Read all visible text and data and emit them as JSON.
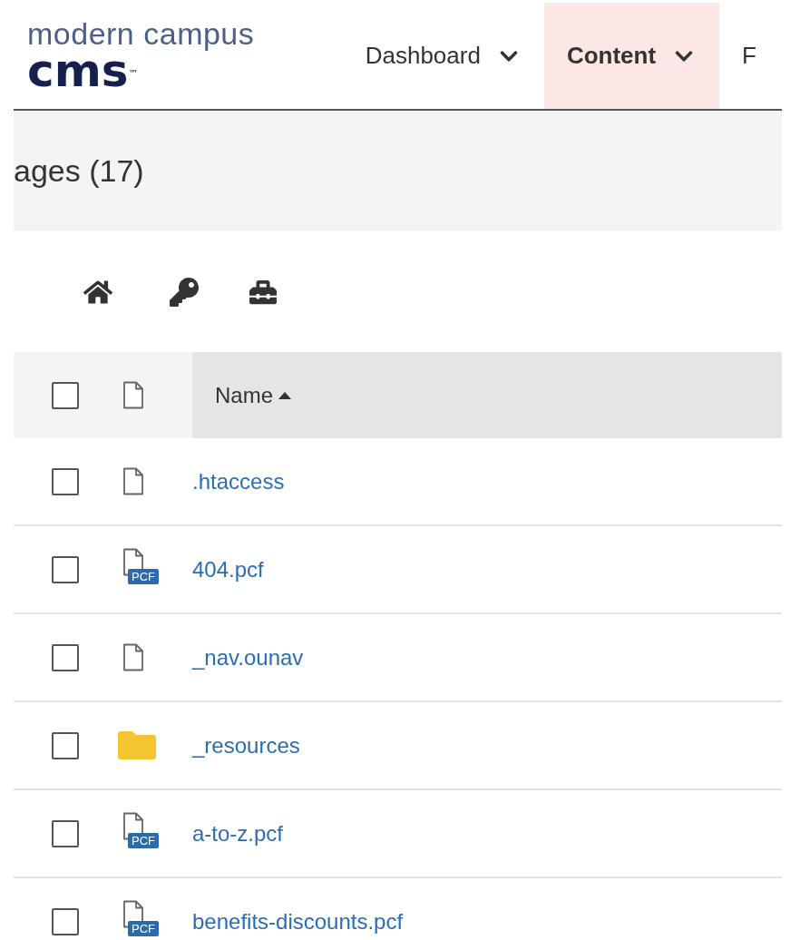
{
  "logo": {
    "line1": "modern campus",
    "line2": "cms",
    "mark": "™"
  },
  "nav": [
    {
      "label": "Dashboard",
      "selected": false,
      "dropdown": true
    },
    {
      "label": "Content",
      "selected": true,
      "dropdown": true
    },
    {
      "label": "F",
      "selected": false,
      "dropdown": false
    }
  ],
  "page_title": "ages (17)",
  "toolbar": [
    {
      "kind": "home"
    },
    {
      "kind": "key"
    },
    {
      "kind": "toolbox"
    }
  ],
  "table": {
    "header": {
      "checked": false,
      "name_column": "Name",
      "sort_ascending": true
    },
    "rows": [
      {
        "name": ".htaccess",
        "kind": "file",
        "checked": false
      },
      {
        "name": "404.pcf",
        "kind": "pcf",
        "badge": "PCF",
        "checked": false
      },
      {
        "name": "_nav.ounav",
        "kind": "file",
        "checked": false
      },
      {
        "name": "_resources",
        "kind": "folder",
        "checked": false
      },
      {
        "name": "a-to-z.pcf",
        "kind": "pcf",
        "badge": "PCF",
        "checked": false
      },
      {
        "name": "benefits-discounts.pcf",
        "kind": "pcf",
        "badge": "PCF",
        "checked": false
      }
    ]
  }
}
